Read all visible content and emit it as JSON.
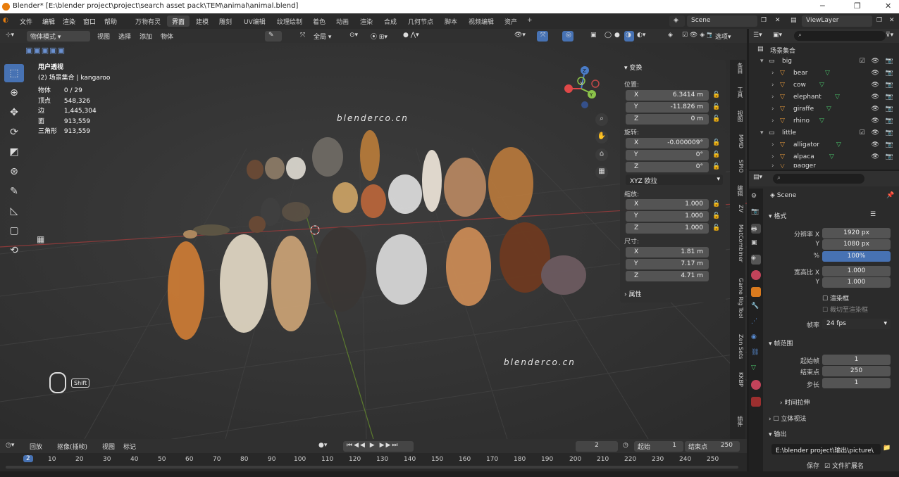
{
  "title_bar": {
    "title": "Blender* [E:\\blender project\\project\\search asset pack\\TEM\\animal\\animal.blend]",
    "min": "─",
    "max": "❐",
    "close": "✕"
  },
  "menu": {
    "items": [
      "文件",
      "编辑",
      "渲染",
      "窗口",
      "帮助"
    ]
  },
  "workspaces": [
    "万物有灵",
    "界面",
    "建模",
    "雕刻",
    "UV编辑",
    "纹理绘制",
    "着色",
    "动画",
    "渲染",
    "合成",
    "几何节点",
    "脚本",
    "视频编辑",
    "资产",
    "+"
  ],
  "scene": {
    "name": "Scene",
    "view_layer": "ViewLayer"
  },
  "viewport_header": {
    "mode": "物体模式",
    "menus": [
      "视图",
      "选择",
      "添加",
      "物体"
    ],
    "transform_orient": "全局",
    "options": "选项"
  },
  "viewport": {
    "view_name": "用户透视",
    "collection_line": "(2) 场景集合 | kangaroo",
    "stats": [
      {
        "k": "物体",
        "v": "0 / 29"
      },
      {
        "k": "顶点",
        "v": "548,326"
      },
      {
        "k": "边",
        "v": "1,445,304"
      },
      {
        "k": "面",
        "v": "913,559"
      },
      {
        "k": "三角形",
        "v": "913,559"
      }
    ],
    "watermark1": "blenderco.cn",
    "watermark2": "blenderco.cn",
    "shift_label": "Shift",
    "gizmo": {
      "x": "X",
      "y": "Y",
      "z": "Z"
    }
  },
  "transform_panel": {
    "title": "变换",
    "location_label": "位置:",
    "location": [
      {
        "ax": "X",
        "v": "6.3414 m"
      },
      {
        "ax": "Y",
        "v": "-11.826 m"
      },
      {
        "ax": "Z",
        "v": "0 m"
      }
    ],
    "rotation_label": "旋转:",
    "rotation": [
      {
        "ax": "X",
        "v": "-0.000009°"
      },
      {
        "ax": "Y",
        "v": "0°"
      },
      {
        "ax": "Z",
        "v": "0°"
      }
    ],
    "rotation_mode": "XYZ 欧拉",
    "scale_label": "缩放:",
    "scale": [
      {
        "ax": "X",
        "v": "1.000"
      },
      {
        "ax": "Y",
        "v": "1.000"
      },
      {
        "ax": "Z",
        "v": "1.000"
      }
    ],
    "dimensions_label": "尺寸:",
    "dimensions": [
      {
        "ax": "X",
        "v": "1.81 m"
      },
      {
        "ax": "Y",
        "v": "7.17 m"
      },
      {
        "ax": "Z",
        "v": "4.71 m"
      }
    ],
    "properties_label": "属性"
  },
  "side_tabs": [
    "条目",
    "工具",
    "视图",
    "MMD",
    "SPIO",
    "编辑",
    "ZV",
    "MatCombiner",
    "Game Rig Tool",
    "Zen Sets",
    "KKBP",
    "插件"
  ],
  "outliner": {
    "root": "场景集合",
    "items": [
      {
        "name": "big",
        "depth": 0,
        "kind": "collection"
      },
      {
        "name": "bear",
        "depth": 1,
        "kind": "object"
      },
      {
        "name": "cow",
        "depth": 1,
        "kind": "object"
      },
      {
        "name": "elephant",
        "depth": 1,
        "kind": "object"
      },
      {
        "name": "giraffe",
        "depth": 1,
        "kind": "object"
      },
      {
        "name": "rhino",
        "depth": 1,
        "kind": "object"
      },
      {
        "name": "little",
        "depth": 0,
        "kind": "collection"
      },
      {
        "name": "alligator",
        "depth": 1,
        "kind": "object"
      },
      {
        "name": "alpaca",
        "depth": 1,
        "kind": "object"
      },
      {
        "name": "badger",
        "depth": 1,
        "kind": "object"
      }
    ]
  },
  "properties": {
    "context": "Scene",
    "format_section": "格式",
    "res_x_label": "分辨率 X",
    "res_x": "1920 px",
    "res_y_label": "Y",
    "res_y": "1080 px",
    "pct_label": "%",
    "pct": "100%",
    "aspect_x_label": "宽高比 X",
    "aspect_x": "1.000",
    "aspect_y_label": "Y",
    "aspect_y": "1.000",
    "render_region": "渲染框",
    "crop": "裁切至渲染框",
    "fps_label": "帧率",
    "fps": "24 fps",
    "frame_range_section": "帧范围",
    "start_label": "起始帧",
    "start": "1",
    "end_label": "结束点",
    "end": "250",
    "step_label": "步长",
    "step": "1",
    "time_stretch": "时间拉伸",
    "stereo": "立体视法",
    "output_section": "输出",
    "output_path": "E:\\blender project\\输出\\picture\\",
    "save_label": "保存",
    "file_ext": "文件扩展名"
  },
  "timeline": {
    "menus": [
      "回放",
      "抠像(插帧)",
      "视图",
      "标记"
    ],
    "current_frame": "2",
    "start_label": "起始",
    "start": "1",
    "end_label": "结束点",
    "end": "250",
    "frame_numbers": [
      "2",
      "10",
      "20",
      "30",
      "40",
      "50",
      "60",
      "70",
      "80",
      "90",
      "100",
      "110",
      "120",
      "130",
      "140",
      "150",
      "160",
      "170",
      "180",
      "190",
      "200",
      "210",
      "220",
      "230",
      "240",
      "250"
    ]
  },
  "colors": {
    "accent": "#4772b3",
    "active_blue": "#4772b3",
    "grid_red": "#8a3a3a",
    "grid_green": "#5b7a2e"
  }
}
